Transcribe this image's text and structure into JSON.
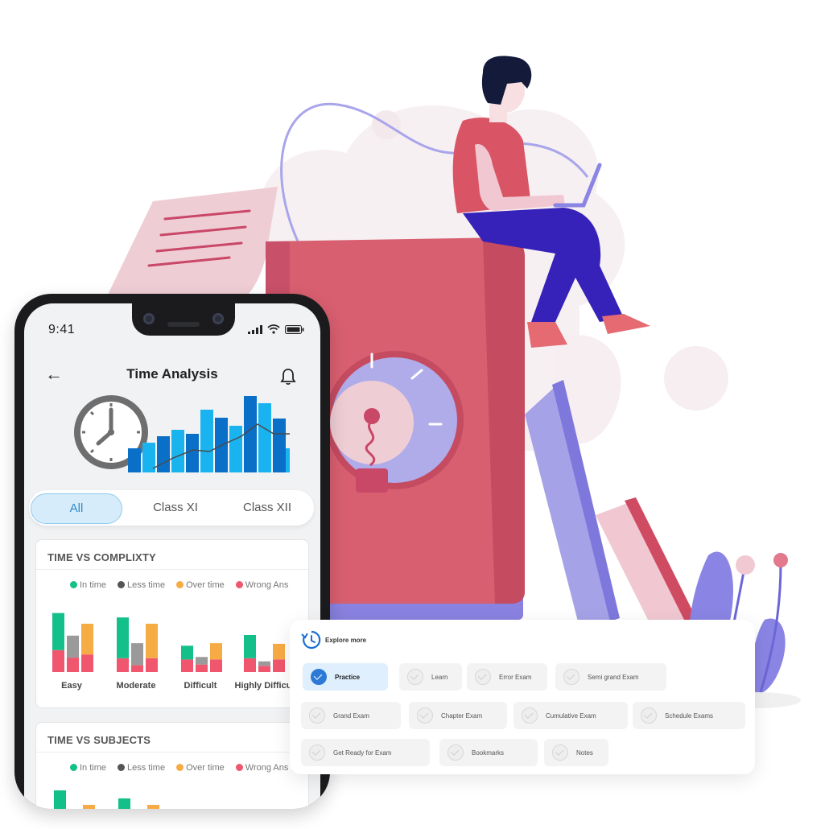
{
  "phone": {
    "status_time": "9:41",
    "title": "Time Analysis",
    "back_icon": "back-arrow-icon",
    "bell_icon": "bell-icon",
    "tabs": [
      {
        "label": "All",
        "active": true
      },
      {
        "label": "Class XI",
        "active": false
      },
      {
        "label": "Class XII",
        "active": false
      }
    ],
    "legend": {
      "in_time": "In time",
      "less_time": "Less time",
      "over_time": "Over time",
      "wrong_ans": "Wrong Ans"
    },
    "colors": {
      "in_time": "#14c08a",
      "less_time": "#9a9a9a",
      "over_time": "#f7ab45",
      "wrong_ans": "#f0566e"
    },
    "section1": {
      "title": "TIME VS COMPLIXTY"
    },
    "section2": {
      "title": "TIME VS SUBJECTS"
    }
  },
  "chart_data": [
    {
      "type": "bar",
      "title": "TIME VS COMPLIXTY",
      "categories": [
        "Easy",
        "Moderate",
        "Difficult",
        "Highly Difficu"
      ],
      "stacked_groups": true,
      "series": [
        {
          "name": "In time",
          "stack": [
            {
              "part": "Wrong Ans",
              "values": [
                3.5,
                2.2,
                2.0,
                2.2
              ]
            },
            {
              "part": "In time",
              "values": [
                5.9,
                6.5,
                2.2,
                3.7
              ]
            }
          ]
        },
        {
          "name": "Less time",
          "stack": [
            {
              "part": "Wrong Ans",
              "values": [
                2.3,
                1.1,
                1.2,
                1.0
              ]
            },
            {
              "part": "Less time",
              "values": [
                3.5,
                3.5,
                1.2,
                0.7
              ]
            }
          ]
        },
        {
          "name": "Over time",
          "stack": [
            {
              "part": "Wrong Ans",
              "values": [
                2.8,
                2.2,
                2.0,
                2.0
              ]
            },
            {
              "part": "Over time",
              "values": [
                4.9,
                5.5,
                2.6,
                2.5
              ]
            }
          ]
        }
      ]
    }
  ],
  "explore": {
    "title": "Explore more",
    "icon": "clock-refresh-icon",
    "items": [
      {
        "label": "Practice",
        "selected": true
      },
      {
        "label": "Learn",
        "selected": false
      },
      {
        "label": "Error Exam",
        "selected": false
      },
      {
        "label": "Semi grand Exam",
        "selected": false
      },
      {
        "label": "Grand Exam",
        "selected": false
      },
      {
        "label": "Chapter  Exam",
        "selected": false
      },
      {
        "label": "Cumulative  Exam",
        "selected": false
      },
      {
        "label": "Schedule Exams",
        "selected": false
      },
      {
        "label": "Get Ready for Exam",
        "selected": false
      },
      {
        "label": "Bookmarks",
        "selected": false
      },
      {
        "label": "Notes",
        "selected": false
      }
    ]
  }
}
